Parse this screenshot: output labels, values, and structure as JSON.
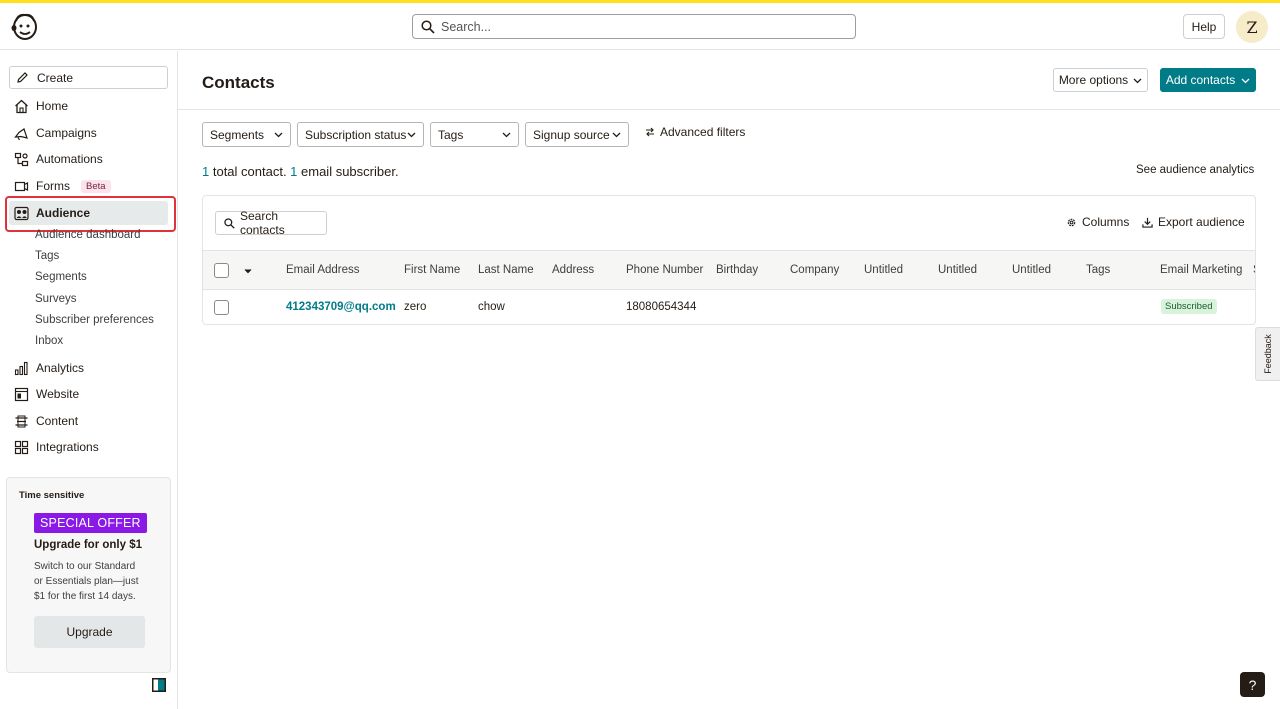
{
  "topbar": {
    "search_placeholder": "Search...",
    "help_label": "Help",
    "avatar_initial": "Z"
  },
  "sidebar": {
    "create_label": "Create",
    "items": [
      {
        "label": "Home",
        "icon": "home-icon"
      },
      {
        "label": "Campaigns",
        "icon": "megaphone-icon"
      },
      {
        "label": "Automations",
        "icon": "automation-icon"
      },
      {
        "label": "Forms",
        "icon": "form-icon",
        "badge": "Beta"
      },
      {
        "label": "Audience",
        "icon": "audience-icon",
        "active": true
      },
      {
        "label": "Analytics",
        "icon": "bar-chart-icon"
      },
      {
        "label": "Website",
        "icon": "website-icon"
      },
      {
        "label": "Content",
        "icon": "content-icon"
      },
      {
        "label": "Integrations",
        "icon": "grid-icon"
      }
    ],
    "audience_sub": [
      "Audience dashboard",
      "Tags",
      "Segments",
      "Surveys",
      "Subscriber preferences",
      "Inbox"
    ],
    "promo": {
      "time_sensitive": "Time sensitive",
      "offer": "SPECIAL OFFER",
      "headline": "Upgrade for only $1",
      "description": "Switch to our Standard or Essentials plan—just $1 for the first 14 days.",
      "button": "Upgrade"
    }
  },
  "header": {
    "title": "Contacts",
    "more_options": "More options",
    "add_contacts": "Add contacts"
  },
  "filters": {
    "segments": "Segments",
    "subscription_status": "Subscription status",
    "tags": "Tags",
    "signup_source": "Signup source",
    "advanced": "Advanced filters"
  },
  "summary": {
    "total_count": "1",
    "total_text": " total contact. ",
    "email_count": "1",
    "email_text": " email subscriber.",
    "analytics_link": "See audience analytics"
  },
  "table": {
    "search_label": "Search contacts",
    "columns_label": "Columns",
    "export_label": "Export audience",
    "headers": [
      "Email Address",
      "First Name",
      "Last Name",
      "Address",
      "Phone Number",
      "Birthday",
      "Company",
      "Untitled",
      "Untitled",
      "Untitled",
      "Tags",
      "Email Marketing",
      "S"
    ],
    "rows": [
      {
        "email": "412343709@qq.com",
        "first_name": "zero",
        "last_name": "chow",
        "address": "",
        "phone": "18080654344",
        "status": "Subscribed"
      }
    ]
  },
  "floating": {
    "feedback": "Feedback",
    "help": "?"
  },
  "colors": {
    "brand_yellow": "#ffe01b",
    "accent_teal": "#007c89",
    "offer_purple": "#8a19e6",
    "highlight_red": "#e0323a"
  }
}
